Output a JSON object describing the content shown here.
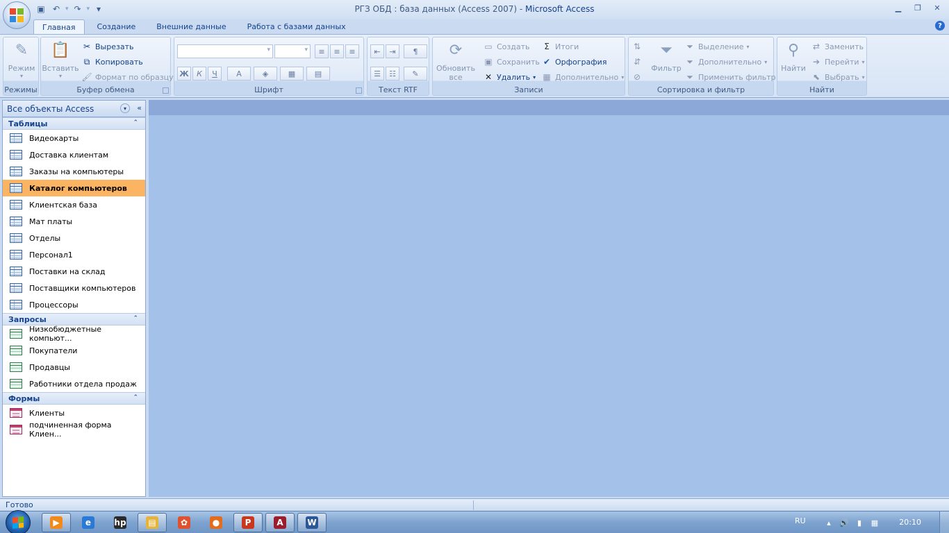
{
  "window": {
    "title_doc": "РГЗ ОБД : база данных (Access 2007) -",
    "title_app": "Microsoft Access"
  },
  "ribbon_tabs": [
    {
      "label": "Главная",
      "active": true
    },
    {
      "label": "Создание",
      "active": false
    },
    {
      "label": "Внешние данные",
      "active": false
    },
    {
      "label": "Работа с базами данных",
      "active": false
    }
  ],
  "ribbon": {
    "views": {
      "group": "Режимы",
      "mode_label": "Режим"
    },
    "clipboard": {
      "group": "Буфер обмена",
      "paste": "Вставить",
      "cut": "Вырезать",
      "copy": "Копировать",
      "format_painter": "Формат по образцу"
    },
    "font": {
      "group": "Шрифт",
      "bold": "Ж",
      "italic": "К",
      "underline": "Ч",
      "font_color": "A"
    },
    "rtf": {
      "group": "Текст RTF"
    },
    "records": {
      "group": "Записи",
      "refresh": "Обновить",
      "refresh_sub": "все",
      "new": "Создать",
      "save": "Сохранить",
      "delete": "Удалить",
      "totals": "Итоги",
      "spelling": "Орфография",
      "more": "Дополнительно"
    },
    "sort_filter": {
      "group": "Сортировка и фильтр",
      "filter": "Фильтр",
      "selection": "Выделение",
      "advanced": "Дополнительно",
      "toggle_filter": "Применить фильтр"
    },
    "find": {
      "group": "Найти",
      "find": "Найти",
      "replace": "Заменить",
      "goto": "Перейти",
      "select": "Выбрать"
    }
  },
  "nav_pane": {
    "header": "Все объекты Access",
    "sections": [
      {
        "title": "Таблицы",
        "kind": "table",
        "items": [
          "Видеокарты",
          "Доставка клиентам",
          "Заказы на компьютеры",
          "Каталог компьютеров",
          "Клиентская база",
          "Мат платы",
          "Отделы",
          "Персонал1",
          "Поставки на склад",
          "Поставщики компьютеров",
          "Процессоры"
        ],
        "selected_index": 3
      },
      {
        "title": "Запросы",
        "kind": "query",
        "items": [
          "Низкобюджетные компьют...",
          "Покупатели",
          "Продавцы",
          "Работники отдела продаж"
        ]
      },
      {
        "title": "Формы",
        "kind": "form",
        "items": [
          "Клиенты",
          "подчиненная форма Клиен..."
        ]
      }
    ]
  },
  "status": {
    "text": "Готово"
  },
  "taskbar": {
    "lang": "RU",
    "clock": "20:10",
    "apps": [
      {
        "name": "media-player-icon",
        "glyph": "▶",
        "color": "#f08a1c",
        "framed": true
      },
      {
        "name": "internet-explorer-icon",
        "glyph": "e",
        "color": "#2a79d4",
        "framed": false
      },
      {
        "name": "hp-icon",
        "glyph": "hp",
        "color": "#2a2a2a",
        "framed": false
      },
      {
        "name": "file-explorer-icon",
        "glyph": "▤",
        "color": "#e4b43c",
        "framed": true
      },
      {
        "name": "paint-icon",
        "glyph": "✿",
        "color": "#e0522e",
        "framed": false
      },
      {
        "name": "firefox-icon",
        "glyph": "●",
        "color": "#e36d1c",
        "framed": false
      },
      {
        "name": "powerpoint-icon",
        "glyph": "P",
        "color": "#c8381e",
        "framed": true
      },
      {
        "name": "access-icon",
        "glyph": "A",
        "color": "#9b1d2d",
        "framed": true
      },
      {
        "name": "word-icon",
        "glyph": "W",
        "color": "#2b5797",
        "framed": true
      }
    ]
  }
}
